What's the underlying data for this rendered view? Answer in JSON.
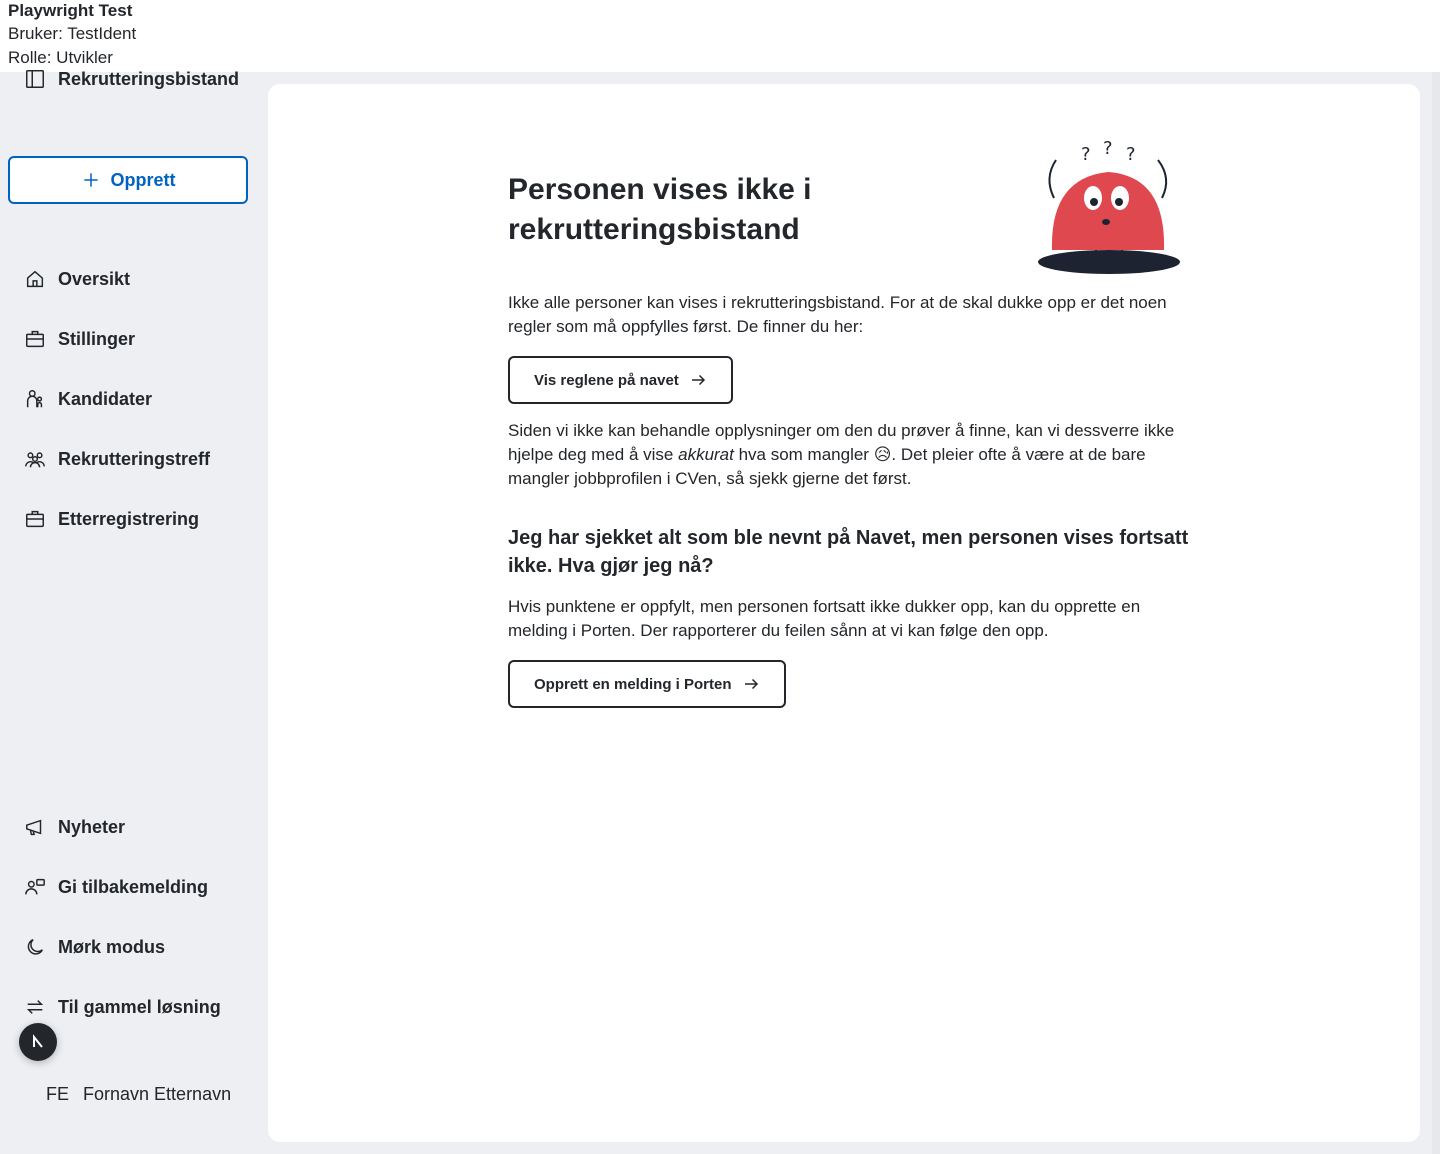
{
  "topbar": {
    "title": "Playwright Test",
    "user_line": "Bruker: TestIdent",
    "role_line": "Rolle: Utvikler"
  },
  "sidebar": {
    "brand": "Rekrutteringsbistand",
    "create_label": "Opprett",
    "nav": [
      {
        "label": "Oversikt",
        "icon": "home-icon"
      },
      {
        "label": "Stillinger",
        "icon": "briefcase-icon"
      },
      {
        "label": "Kandidater",
        "icon": "person-child-icon"
      },
      {
        "label": "Rekrutteringstreff",
        "icon": "people-group-icon"
      },
      {
        "label": "Etterregistrering",
        "icon": "briefcase-icon"
      }
    ],
    "bottom_nav": [
      {
        "label": "Nyheter",
        "icon": "megaphone-icon"
      },
      {
        "label": "Gi tilbakemelding",
        "icon": "feedback-icon"
      },
      {
        "label": "Mørk modus",
        "icon": "moon-icon"
      },
      {
        "label": "Til gammel løsning",
        "icon": "arrows-swap-icon"
      }
    ],
    "fab_icon": "n-logo-icon",
    "user_initials": "FE",
    "user_name": "Fornavn Etternavn"
  },
  "main": {
    "heading": "Personen vises ikke i rekrutteringsbistand",
    "intro": "Ikke alle personer kan vises i rekrutteringsbistand. For at de skal dukke opp er det noen regler som må oppfylles først. De finner du her:",
    "rules_button": "Vis reglene på navet",
    "explanation_before": "Siden vi ikke kan behandle opplysninger om den du prøver å finne, kan vi dessverre ikke hjelpe deg med å vise ",
    "explanation_emphasis": "akkurat",
    "explanation_after": " hva som mangler 😥. Det pleier ofte å være at de bare mangler jobbprofilen i CVen, så sjekk gjerne det først.",
    "subheading": "Jeg har sjekket alt som ble nevnt på Navet, men personen vises fortsatt ikke. Hva gjør jeg nå?",
    "porten_text": "Hvis punktene er oppfylt, men personen fortsatt ikke dukker opp, kan du opprette en melding i Porten. Der rapporterer du feilen sånn at vi kan følge den opp.",
    "porten_button": "Opprett en melding i Porten"
  },
  "colors": {
    "accent": "#0063c1",
    "sidebar_bg": "#edeff2",
    "text": "#23262a",
    "illustration_red": "#e0484f",
    "illustration_shadow": "#1d2330"
  }
}
